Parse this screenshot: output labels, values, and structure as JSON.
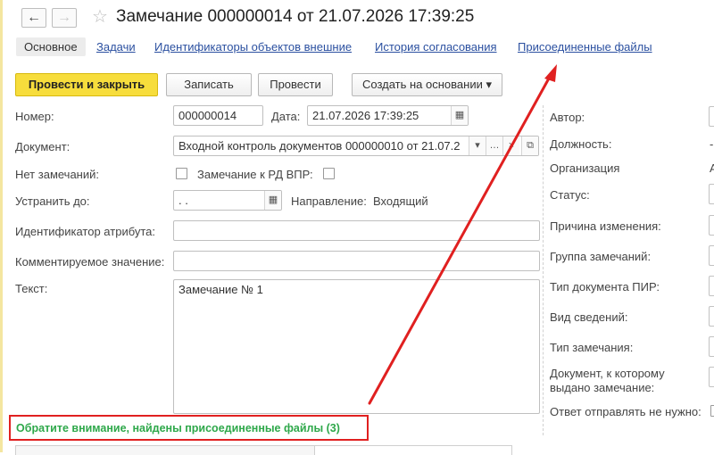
{
  "window": {
    "title": "Замечание 000000014 от 21.07.2026 17:39:25"
  },
  "nav": {
    "back_glyph": "←",
    "forward_glyph": "→",
    "star_glyph": "☆"
  },
  "tabs": [
    {
      "label": "Основное",
      "active": true
    },
    {
      "label": "Задачи"
    },
    {
      "label": "Идентификаторы объектов внешние"
    },
    {
      "label": "История согласования"
    },
    {
      "label": "Присоединенные файлы"
    }
  ],
  "toolbar": {
    "post_close": "Провести и закрыть",
    "save": "Записать",
    "post": "Провести",
    "create_based": "Создать на основании",
    "create_based_arrow": "▾"
  },
  "form": {
    "number_label": "Номер:",
    "number_value": "000000014",
    "date_label": "Дата:",
    "date_value": "21.07.2026 17:39:25",
    "document_label": "Документ:",
    "document_value": "Входной контроль документов 000000010 от 21.07.2",
    "no_remarks_label": "Нет замечаний:",
    "rd_remark_label": "Замечание к РД ВПР:",
    "fix_until_label": "Устранить до:",
    "fix_until_value": " .  .",
    "direction_label": "Направление:",
    "direction_value": "Входящий",
    "attr_id_label": "Идентификатор атрибута:",
    "commented_value_label": "Комментируемое значение:",
    "text_label": "Текст:",
    "text_value": "Замечание № 1"
  },
  "right_panel": {
    "author": "Автор:",
    "position": "Должность:",
    "position_value": "-",
    "organization": "Организация",
    "organization_value": "А",
    "status": "Статус:",
    "change_reason": "Причина изменения:",
    "remark_group": "Группа замечаний:",
    "pir_doc_type": "Тип документа ПИР:",
    "info_kind": "Вид сведений:",
    "remark_type": "Тип замечания:",
    "doc_issued_line1": "Документ, к которому",
    "doc_issued_line2": "выдано замечание:",
    "no_reply": "Ответ отправлять не нужно:"
  },
  "notice": {
    "text": "Обратите внимание, найдены присоединенные файлы (3)"
  },
  "colors": {
    "accent_yellow": "#f7dd3c",
    "link_blue": "#2b50a0",
    "notice_green": "#2ea84a",
    "highlight_red": "#e02020"
  }
}
